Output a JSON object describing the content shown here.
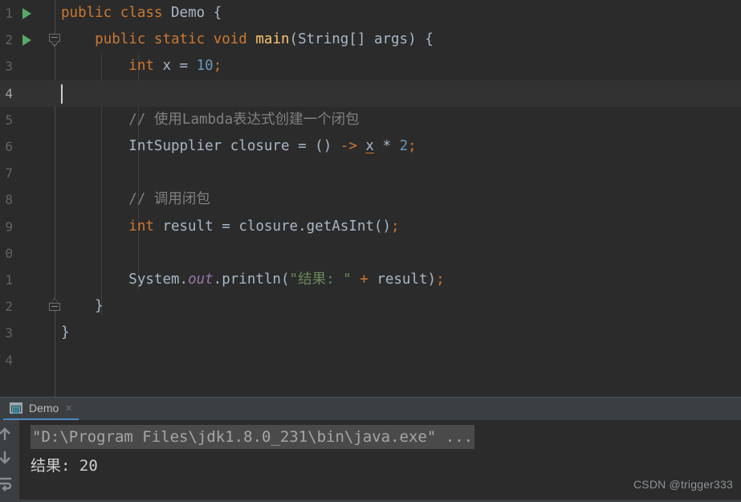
{
  "editor": {
    "language": "java",
    "current_line": 4,
    "background": "#2b2b2b",
    "current_line_background": "#323232",
    "lines": [
      {
        "number": "1",
        "has_run_arrow": true,
        "fold": "none"
      },
      {
        "number": "2",
        "has_run_arrow": true,
        "fold": "down"
      },
      {
        "number": "3",
        "has_run_arrow": false,
        "fold": "none"
      },
      {
        "number": "4",
        "has_run_arrow": false,
        "fold": "none"
      },
      {
        "number": "5",
        "has_run_arrow": false,
        "fold": "none"
      },
      {
        "number": "6",
        "has_run_arrow": false,
        "fold": "none"
      },
      {
        "number": "7",
        "has_run_arrow": false,
        "fold": "none"
      },
      {
        "number": "8",
        "has_run_arrow": false,
        "fold": "none"
      },
      {
        "number": "9",
        "has_run_arrow": false,
        "fold": "none"
      },
      {
        "number": "0",
        "has_run_arrow": false,
        "fold": "none"
      },
      {
        "number": "1",
        "has_run_arrow": false,
        "fold": "none"
      },
      {
        "number": "2",
        "has_run_arrow": false,
        "fold": "up"
      },
      {
        "number": "3",
        "has_run_arrow": false,
        "fold": "none"
      },
      {
        "number": "4",
        "has_run_arrow": false,
        "fold": "none"
      }
    ],
    "code": {
      "line1": "public class Demo {",
      "line2": "    public static void main(String[] args) {",
      "line3": "        int x = 10;",
      "line4": "",
      "line5": "        // 使用Lambda表达式创建一个闭包",
      "line6": "        IntSupplier closure = () -> x * 2;",
      "line7": "",
      "line8": "        // 调用闭包",
      "line9": "        int result = closure.getAsInt();",
      "line10": "",
      "line11": "        System.out.println(\"结果: \" + result);",
      "line12": "    }",
      "line13": "}",
      "line14": ""
    },
    "tokens": {
      "kw_public": "public",
      "kw_class": "class",
      "kw_static": "static",
      "kw_void": "void",
      "kw_int": "int",
      "name_demo": "Demo",
      "name_main": "main",
      "type_string_arr": "String[]",
      "name_args": "args",
      "name_x": "x",
      "num_10": "10",
      "num_2": "2",
      "comment_5": "// 使用Lambda表达式创建一个闭包",
      "comment_8": "// 调用闭包",
      "type_intsupplier": "IntSupplier",
      "name_closure": "closure",
      "arrow": "->",
      "name_result": "result",
      "name_getasint": "getAsInt",
      "name_system": "System",
      "field_out": "out",
      "name_println": "println",
      "string_result": "\"结果: \"",
      "plus": "+",
      "open_brace": "{",
      "close_brace": "}",
      "semicolon": ";",
      "equals": "=",
      "star": "*",
      "dot": ".",
      "parens_empty": "()",
      "lparen": "(",
      "rparen": ")"
    },
    "colors": {
      "keyword": "#cc7832",
      "number": "#6897bb",
      "string": "#6a8759",
      "comment": "#808080",
      "method": "#ffc66d",
      "field": "#9876aa",
      "identifier": "#a9b7c6",
      "run_arrow": "#59a869"
    }
  },
  "console": {
    "tab": {
      "label": "Demo",
      "close_label": "×",
      "icon": "console-window-icon",
      "active_underline": "#4a88c7"
    },
    "toolbar": [
      {
        "name": "scroll-up-button",
        "icon": "arrow-up-icon"
      },
      {
        "name": "scroll-down-button",
        "icon": "arrow-down-icon"
      },
      {
        "name": "soft-wrap-button",
        "icon": "soft-wrap-icon"
      }
    ],
    "output": {
      "command_line": "\"D:\\Program Files\\jdk1.8.0_231\\bin\\java.exe\" ...",
      "result_line": "结果: 20"
    }
  },
  "watermark": {
    "text": "CSDN @trigger333"
  }
}
